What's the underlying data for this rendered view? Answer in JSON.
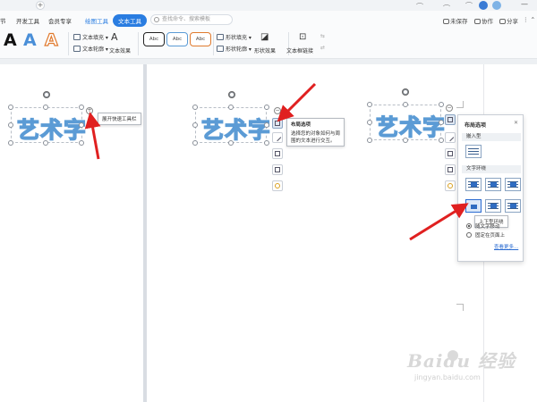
{
  "tabbar": {
    "new_tab": "+"
  },
  "menubar": {
    "items": [
      {
        "label": "节"
      },
      {
        "label": "开发工具"
      },
      {
        "label": "会员专享"
      },
      {
        "label": "绘图工具"
      },
      {
        "label": "文本工具"
      }
    ],
    "search_placeholder": "查找命令、搜索模板",
    "right": {
      "unsaved": "未保存",
      "collab": "协作",
      "share": "分享"
    }
  },
  "ribbon": {
    "big_letters": [
      "A",
      "A",
      "A"
    ],
    "text_fill": "文本填充",
    "text_outline": "文本轮廓",
    "text_effect": "文本效果",
    "styles": [
      "Abc",
      "Abc",
      "Abc"
    ],
    "shape_fill": "形状填充",
    "shape_outline": "形状轮廓",
    "shape_effect": "形状效果",
    "textbox_link": "文本框链接"
  },
  "canvas": {
    "art_text": "艺术字",
    "expand_tooltip": "展开快速工具栏",
    "layout_tooltip": {
      "title": "布局选项",
      "line1": "选择您的对象如何与周",
      "line2": "围的文本进行交互。"
    }
  },
  "layout_panel": {
    "title": "布局选项",
    "close": "✕",
    "inline_header": "嵌入型",
    "wrap_header": "文字环绕",
    "hover_tooltip": "上下型环绕",
    "radio_move": "随文字移动",
    "radio_fixed": "固定在页面上",
    "more": "查看更多..."
  },
  "watermark": {
    "main": "Baidu 经验",
    "sub": "jingyan.baidu.com"
  },
  "colors": {
    "accent": "#2a7de1",
    "art_outline": "#5b9bd5",
    "arrow": "#e02020"
  }
}
